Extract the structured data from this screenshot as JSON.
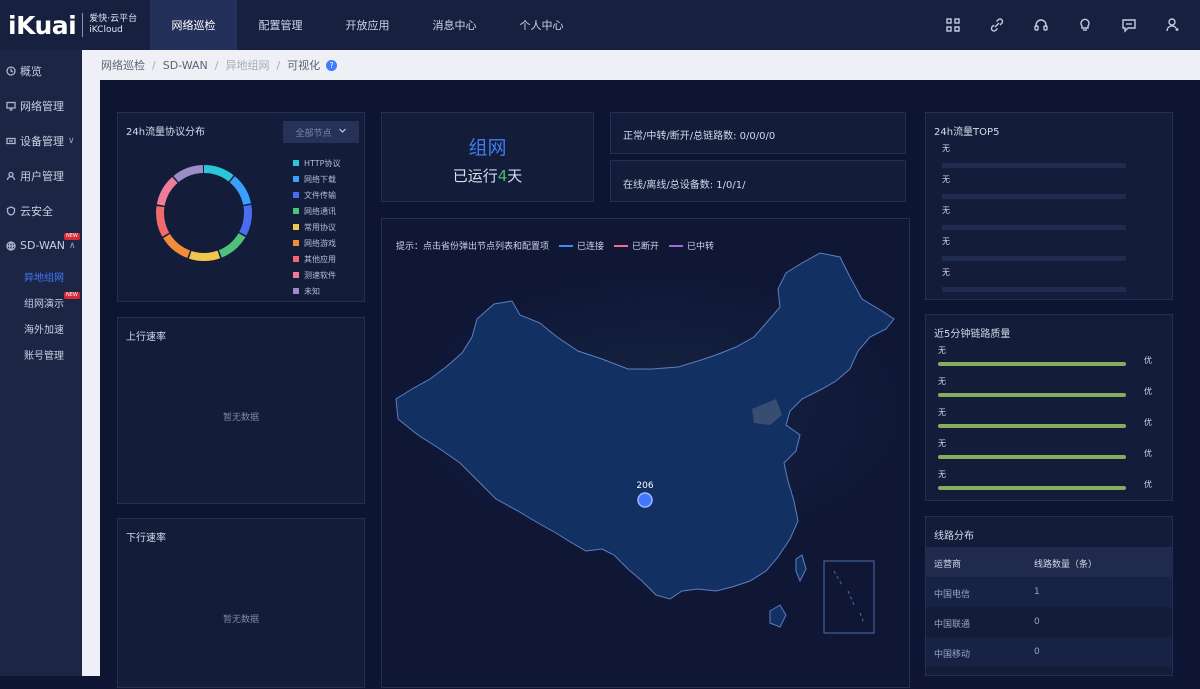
{
  "brand": {
    "logo": "iKuai",
    "line1": "爱快·云平台",
    "line2": "iKCloud"
  },
  "nav": [
    "网络巡检",
    "配置管理",
    "开放应用",
    "消息中心",
    "个人中心"
  ],
  "nav_icons": [
    "grid-icon",
    "link-icon",
    "headset-icon",
    "lightbulb-icon",
    "chat-icon",
    "user-settings-icon"
  ],
  "sidebar": {
    "items": [
      {
        "label": "概览"
      },
      {
        "label": "网络管理"
      },
      {
        "label": "设备管理",
        "caret": "∨"
      },
      {
        "label": "用户管理"
      },
      {
        "label": "云安全"
      },
      {
        "label": "SD-WAN",
        "caret": "∧",
        "badge": "NEW"
      }
    ],
    "subitems": [
      {
        "label": "异地组网",
        "active": true
      },
      {
        "label": "组网演示",
        "badge": "NEW"
      },
      {
        "label": "海外加速"
      },
      {
        "label": "账号管理"
      }
    ]
  },
  "breadcrumb": {
    "a": "网络巡检",
    "b": "SD-WAN",
    "c": "异地组网",
    "d": "可视化",
    "sep": "/",
    "help": "?"
  },
  "protocol": {
    "title": "24h流量协议分布",
    "select": "全部节点",
    "legend": [
      {
        "label": "HTTP协议",
        "color": "#2bc6d8"
      },
      {
        "label": "网络下载",
        "color": "#3aa0ff"
      },
      {
        "label": "文件传输",
        "color": "#4a6cf0"
      },
      {
        "label": "网络通讯",
        "color": "#4ec07c"
      },
      {
        "label": "常用协议",
        "color": "#f2c54b"
      },
      {
        "label": "网络游戏",
        "color": "#f28b3c"
      },
      {
        "label": "其他应用",
        "color": "#ef6a6a"
      },
      {
        "label": "测速软件",
        "color": "#f07c9a"
      },
      {
        "label": "未知",
        "color": "#9b8ec7"
      }
    ]
  },
  "upload": {
    "title": "上行速率",
    "empty": "暂无数据"
  },
  "download": {
    "title": "下行速率",
    "empty": "暂无数据"
  },
  "network": {
    "title": "组网",
    "prefix": "已运行",
    "days": "4",
    "suffix": "天"
  },
  "links": "正常/中转/断开/总链路数: 0/0/0/0",
  "devices": "在线/离线/总设备数: 1/0/1/",
  "map": {
    "tip": "提示：点击省份弹出节点列表和配置项",
    "keys": [
      {
        "label": "已连接",
        "color": "#3f87ff"
      },
      {
        "label": "已断开",
        "color": "#f0708a"
      },
      {
        "label": "已中转",
        "color": "#9b6dd6"
      }
    ],
    "node_label": "206"
  },
  "top5": {
    "title": "24h流量TOP5",
    "rows": [
      "无",
      "无",
      "无",
      "无",
      "无"
    ]
  },
  "quality": {
    "title": "近5分钟链路质量",
    "rows": [
      {
        "label": "无",
        "grade": "优"
      },
      {
        "label": "无",
        "grade": "优"
      },
      {
        "label": "无",
        "grade": "优"
      },
      {
        "label": "无",
        "grade": "优"
      },
      {
        "label": "无",
        "grade": "优"
      }
    ]
  },
  "lines": {
    "title": "线路分布",
    "headers": [
      "运营商",
      "线路数量（条）"
    ],
    "rows": [
      [
        "中国电信",
        "1"
      ],
      [
        "中国联通",
        "0"
      ],
      [
        "中国移动",
        "0"
      ]
    ]
  }
}
